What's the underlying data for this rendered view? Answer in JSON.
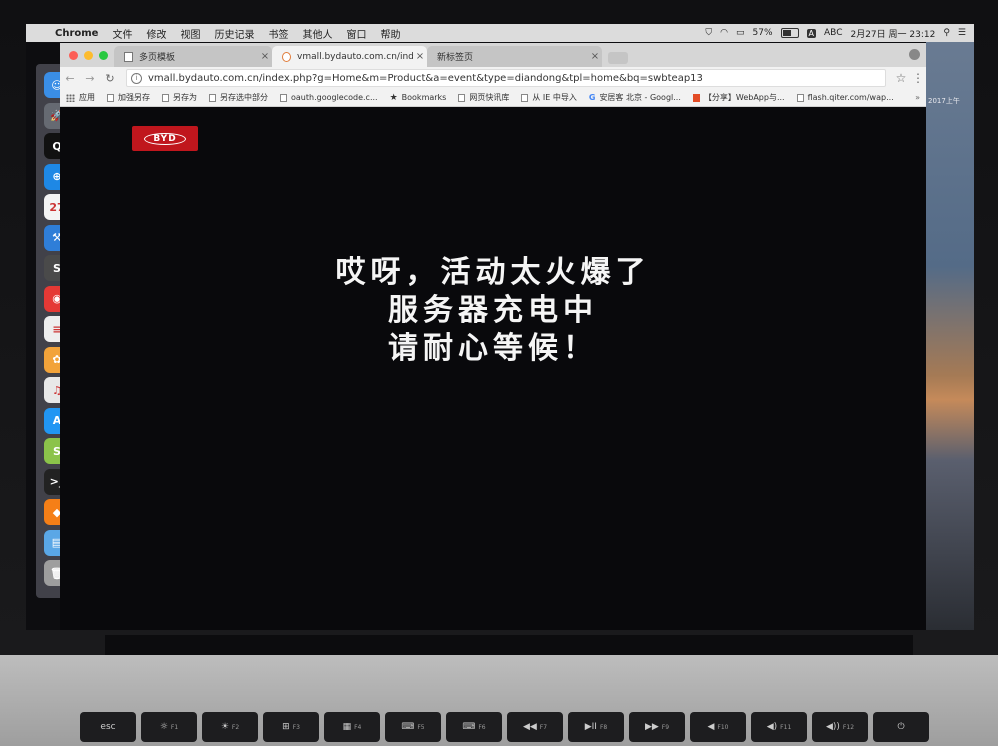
{
  "menubar": {
    "app_name": "Chrome",
    "menus": [
      "文件",
      "修改",
      "视图",
      "历史记录",
      "书签",
      "其他人",
      "窗口",
      "帮助"
    ],
    "battery": "57%",
    "input_method": "ABC",
    "datetime": "2月27日 周一  23:12"
  },
  "browser": {
    "tabs": [
      {
        "title": "多页模板",
        "active": false
      },
      {
        "title": "vmall.bydauto.com.cn/index.p",
        "active": true
      },
      {
        "title": "新标签页",
        "active": false
      }
    ],
    "url": "vmall.bydauto.com.cn/index.php?g=Home&m=Product&a=event&type=diandong&tpl=home&bq=swbteap13",
    "bookmarks": [
      {
        "label": "应用",
        "icon": "apps-grid-icon"
      },
      {
        "label": "加强另存",
        "icon": "page-icon"
      },
      {
        "label": "另存为",
        "icon": "page-icon"
      },
      {
        "label": "另存选中部分",
        "icon": "page-icon"
      },
      {
        "label": "oauth.googlecode.c...",
        "icon": "page-icon"
      },
      {
        "label": "Bookmarks",
        "icon": "star-icon"
      },
      {
        "label": "网页快讯库",
        "icon": "page-icon"
      },
      {
        "label": "从 IE 中导入",
        "icon": "folder-icon"
      },
      {
        "label": "安居客 北京 - Googl...",
        "icon": "google-icon"
      },
      {
        "label": "【分享】WebApp与...",
        "icon": "html5-icon"
      },
      {
        "label": "flash.qiter.com/wap...",
        "icon": "page-icon"
      }
    ],
    "bookmarks_overflow": "»"
  },
  "page": {
    "logo_text": "BYD",
    "message_lines": [
      "哎呀，活动太火爆了",
      "服务器充电中",
      "请耐心等候！"
    ]
  },
  "desktop": {
    "wallpaper_label": "2017上午"
  },
  "dock": {
    "icons": [
      {
        "name": "finder-icon",
        "glyph": "☺",
        "color": "#3a8ee6"
      },
      {
        "name": "launchpad-icon",
        "glyph": "🚀",
        "color": "#666a72"
      },
      {
        "name": "qq-icon",
        "glyph": "Q",
        "color": "#111111"
      },
      {
        "name": "safari-icon",
        "glyph": "⊕",
        "color": "#1e88e5"
      },
      {
        "name": "calendar-icon",
        "glyph": "27",
        "color": "#f4f4f4"
      },
      {
        "name": "xcode-icon",
        "glyph": "⚒",
        "color": "#2f7ed8"
      },
      {
        "name": "sublime-icon",
        "glyph": "S",
        "color": "#4a4a4a"
      },
      {
        "name": "chrome-icon",
        "glyph": "◉",
        "color": "#e53935"
      },
      {
        "name": "notes-icon",
        "glyph": "≡",
        "color": "#eeeeee"
      },
      {
        "name": "photos-icon",
        "glyph": "✿",
        "color": "#f2a33a"
      },
      {
        "name": "itunes-icon",
        "glyph": "♫",
        "color": "#e8e8e8"
      },
      {
        "name": "appstore-icon",
        "glyph": "A",
        "color": "#2196f3"
      },
      {
        "name": "music-app-icon",
        "glyph": "S",
        "color": "#8bc34a"
      },
      {
        "name": "terminal-icon",
        "glyph": ">_",
        "color": "#222222"
      },
      {
        "name": "sketch-icon",
        "glyph": "◆",
        "color": "#f57f17"
      },
      {
        "name": "folder-icon",
        "glyph": "▤",
        "color": "#5aa7e6"
      },
      {
        "name": "trash-icon",
        "glyph": "🗑",
        "color": "#9e9e9e"
      }
    ]
  },
  "keyboard": {
    "keys": [
      {
        "label": "esc",
        "fn": ""
      },
      {
        "label": "☼",
        "fn": "F1"
      },
      {
        "label": "☀",
        "fn": "F2"
      },
      {
        "label": "⊞",
        "fn": "F3"
      },
      {
        "label": "▦",
        "fn": "F4"
      },
      {
        "label": "⌨",
        "fn": "F5"
      },
      {
        "label": "⌨",
        "fn": "F6"
      },
      {
        "label": "◀◀",
        "fn": "F7"
      },
      {
        "label": "▶II",
        "fn": "F8"
      },
      {
        "label": "▶▶",
        "fn": "F9"
      },
      {
        "label": "◀",
        "fn": "F10"
      },
      {
        "label": "◀)",
        "fn": "F11"
      },
      {
        "label": "◀))",
        "fn": "F12"
      },
      {
        "label": "⏻",
        "fn": ""
      }
    ]
  }
}
